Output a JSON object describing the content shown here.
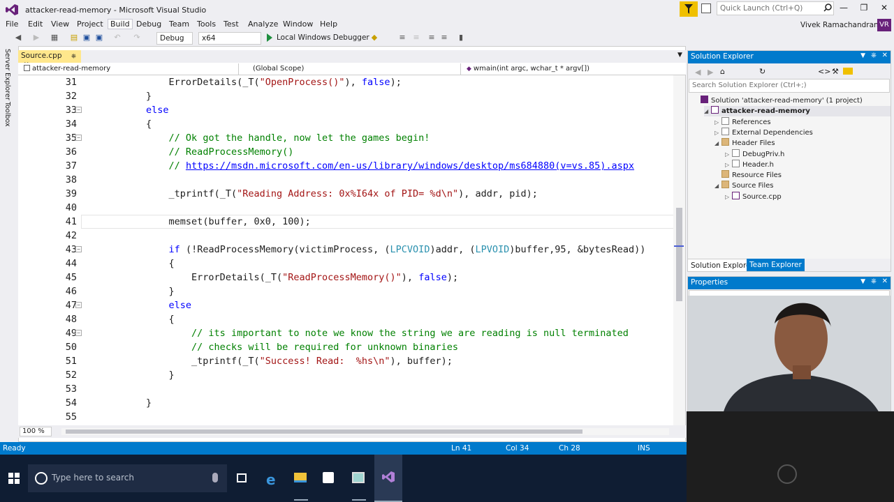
{
  "window": {
    "title": "attacker-read-memory - Microsoft Visual Studio",
    "quick_launch_placeholder": "Quick Launch (Ctrl+Q)",
    "user_name": "Vivek Ramachandran",
    "user_initials": "VR"
  },
  "menu": [
    "File",
    "Edit",
    "View",
    "Project",
    "Build",
    "Debug",
    "Team",
    "Tools",
    "Test",
    "Analyze",
    "Window",
    "Help"
  ],
  "toolbar": {
    "config": "Debug",
    "platform": "x64",
    "debugger": "Local Windows Debugger"
  },
  "side_tabs": [
    "Server Explorer",
    "Toolbox"
  ],
  "editor": {
    "tab_label": "Source.cpp",
    "nav_project": "attacker-read-memory",
    "nav_scope": "(Global Scope)",
    "nav_function": "wmain(int argc, wchar_t * argv[])",
    "zoom": "100 %"
  },
  "code_lines": [
    {
      "n": "31",
      "fold": false,
      "indent": "            ",
      "parts": [
        [
          "",
          "ErrorDetails("
        ],
        [
          "",
          "_T("
        ],
        [
          "st",
          "\"OpenProcess()\""
        ],
        [
          "",
          "), "
        ],
        [
          "kw",
          "false"
        ],
        [
          "",
          ");"
        ]
      ]
    },
    {
      "n": "32",
      "fold": false,
      "indent": "        ",
      "parts": [
        [
          "",
          "}"
        ]
      ]
    },
    {
      "n": "33",
      "fold": true,
      "indent": "        ",
      "parts": [
        [
          "kw",
          "else"
        ]
      ]
    },
    {
      "n": "34",
      "fold": false,
      "indent": "        ",
      "parts": [
        [
          "",
          "{"
        ]
      ]
    },
    {
      "n": "35",
      "fold": true,
      "indent": "            ",
      "parts": [
        [
          "cm",
          "// Ok got the handle, now let the games begin!"
        ]
      ]
    },
    {
      "n": "36",
      "fold": false,
      "indent": "            ",
      "parts": [
        [
          "cm",
          "// ReadProcessMemory()"
        ]
      ]
    },
    {
      "n": "37",
      "fold": false,
      "indent": "            ",
      "parts": [
        [
          "cm",
          "// "
        ],
        [
          "lnk",
          "https://msdn.microsoft.com/en-us/library/windows/desktop/ms684880(v=vs.85).aspx"
        ]
      ]
    },
    {
      "n": "38",
      "fold": false,
      "indent": "",
      "parts": []
    },
    {
      "n": "39",
      "fold": false,
      "indent": "            ",
      "parts": [
        [
          "",
          "_tprintf("
        ],
        [
          "",
          "_T("
        ],
        [
          "st",
          "\"Reading Address: 0x%I64x of PID= %d\\n\""
        ],
        [
          "",
          "), addr, pid);"
        ]
      ]
    },
    {
      "n": "40",
      "fold": false,
      "indent": "",
      "parts": []
    },
    {
      "n": "41",
      "fold": false,
      "indent": "            ",
      "parts": [
        [
          "",
          "memset(buffer, 0x0, 100);"
        ]
      ]
    },
    {
      "n": "42",
      "fold": false,
      "indent": "",
      "parts": []
    },
    {
      "n": "43",
      "fold": true,
      "indent": "            ",
      "parts": [
        [
          "kw",
          "if"
        ],
        [
          "",
          " (!ReadProcessMemory(victimProcess, ("
        ],
        [
          "ty",
          "LPCVOID"
        ],
        [
          "",
          ")addr, ("
        ],
        [
          "ty",
          "LPVOID"
        ],
        [
          "",
          ")buffer,95, &bytesRead))"
        ]
      ]
    },
    {
      "n": "44",
      "fold": false,
      "indent": "            ",
      "parts": [
        [
          "",
          "{"
        ]
      ]
    },
    {
      "n": "45",
      "fold": false,
      "indent": "                ",
      "parts": [
        [
          "",
          "ErrorDetails("
        ],
        [
          "",
          "_T("
        ],
        [
          "st",
          "\"ReadProcessMemory()\""
        ],
        [
          "",
          "), "
        ],
        [
          "kw",
          "false"
        ],
        [
          "",
          ");"
        ]
      ]
    },
    {
      "n": "46",
      "fold": false,
      "indent": "            ",
      "parts": [
        [
          "",
          "}"
        ]
      ]
    },
    {
      "n": "47",
      "fold": true,
      "indent": "            ",
      "parts": [
        [
          "kw",
          "else"
        ]
      ]
    },
    {
      "n": "48",
      "fold": false,
      "indent": "            ",
      "parts": [
        [
          "",
          "{"
        ]
      ]
    },
    {
      "n": "49",
      "fold": true,
      "indent": "                ",
      "parts": [
        [
          "cm",
          "// its important to note we know the string we are reading is null terminated"
        ]
      ]
    },
    {
      "n": "50",
      "fold": false,
      "indent": "                ",
      "parts": [
        [
          "cm",
          "// checks will be required for unknown binaries"
        ]
      ]
    },
    {
      "n": "51",
      "fold": false,
      "indent": "                ",
      "parts": [
        [
          "",
          "_tprintf("
        ],
        [
          "",
          "_T("
        ],
        [
          "st",
          "\"Success! Read:  %hs\\n\""
        ],
        [
          "",
          "), buffer);"
        ]
      ]
    },
    {
      "n": "52",
      "fold": false,
      "indent": "            ",
      "parts": [
        [
          "",
          "}"
        ]
      ]
    },
    {
      "n": "53",
      "fold": false,
      "indent": "",
      "parts": []
    },
    {
      "n": "54",
      "fold": false,
      "indent": "        ",
      "parts": [
        [
          "",
          "}"
        ]
      ]
    },
    {
      "n": "55",
      "fold": false,
      "indent": "",
      "parts": []
    }
  ],
  "status": {
    "state": "Ready",
    "ln": "Ln 41",
    "col": "Col 34",
    "ch": "Ch 28",
    "mode": "INS"
  },
  "solution_explorer": {
    "title": "Solution Explorer",
    "search_placeholder": "Search Solution Explorer (Ctrl+;)",
    "nodes": [
      {
        "label": "Solution 'attacker-read-memory' (1 project)",
        "depth": 0,
        "arrow": "",
        "icon": "sol"
      },
      {
        "label": "attacker-read-memory",
        "depth": 1,
        "arrow": "◢",
        "icon": "cpp",
        "bold": true
      },
      {
        "label": "References",
        "depth": 2,
        "arrow": "▷",
        "icon": ""
      },
      {
        "label": "External Dependencies",
        "depth": 2,
        "arrow": "▷",
        "icon": ""
      },
      {
        "label": "Header Files",
        "depth": 2,
        "arrow": "◢",
        "icon": "fold-ic"
      },
      {
        "label": "DebugPriv.h",
        "depth": 3,
        "arrow": "▷",
        "icon": ""
      },
      {
        "label": "Header.h",
        "depth": 3,
        "arrow": "▷",
        "icon": ""
      },
      {
        "label": "Resource Files",
        "depth": 2,
        "arrow": "",
        "icon": "fold-ic"
      },
      {
        "label": "Source Files",
        "depth": 2,
        "arrow": "◢",
        "icon": "fold-ic"
      },
      {
        "label": "Source.cpp",
        "depth": 3,
        "arrow": "▷",
        "icon": "cpp"
      }
    ],
    "tab_solution": "Solution Explorer",
    "tab_team": "Team Explorer"
  },
  "properties": {
    "title": "Properties"
  },
  "taskbar": {
    "search_placeholder": "Type here to search"
  },
  "colors": {
    "accent": "#007acc",
    "vs_purple": "#68217a",
    "taskbar": "#0f1d33"
  }
}
